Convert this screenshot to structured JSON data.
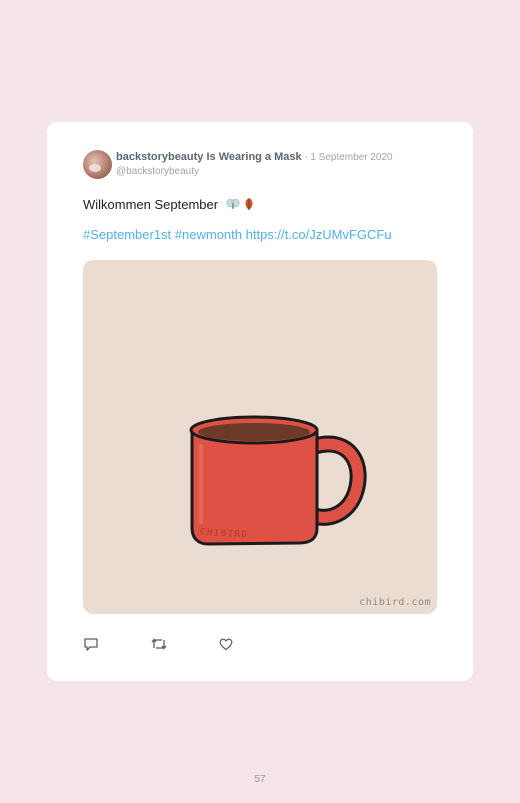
{
  "tweet": {
    "display_name": "backstorybeauty Is Wearing a Mask",
    "separator": "·",
    "date": "1 September 2020",
    "handle": "@backstorybeauty",
    "text": "Wilkommen September",
    "emoji": [
      "fairy-icon",
      "autumn-leaf-icon"
    ],
    "links": [
      "#September1st",
      "#newmonth",
      "https://t.co/JzUMvFGCFu"
    ],
    "media": {
      "description_icon": "red-mug-illustration",
      "mug_label": "CHIBIRD",
      "watermark": "chibird.com"
    },
    "actions": [
      "reply-icon",
      "retweet-icon",
      "like-icon"
    ]
  },
  "page": {
    "number": "57"
  },
  "colors": {
    "background": "#f5e4e8",
    "card": "#ffffff",
    "link": "#51b0e6",
    "media_bg": "#ebdcd1",
    "mug": "#de5246"
  }
}
